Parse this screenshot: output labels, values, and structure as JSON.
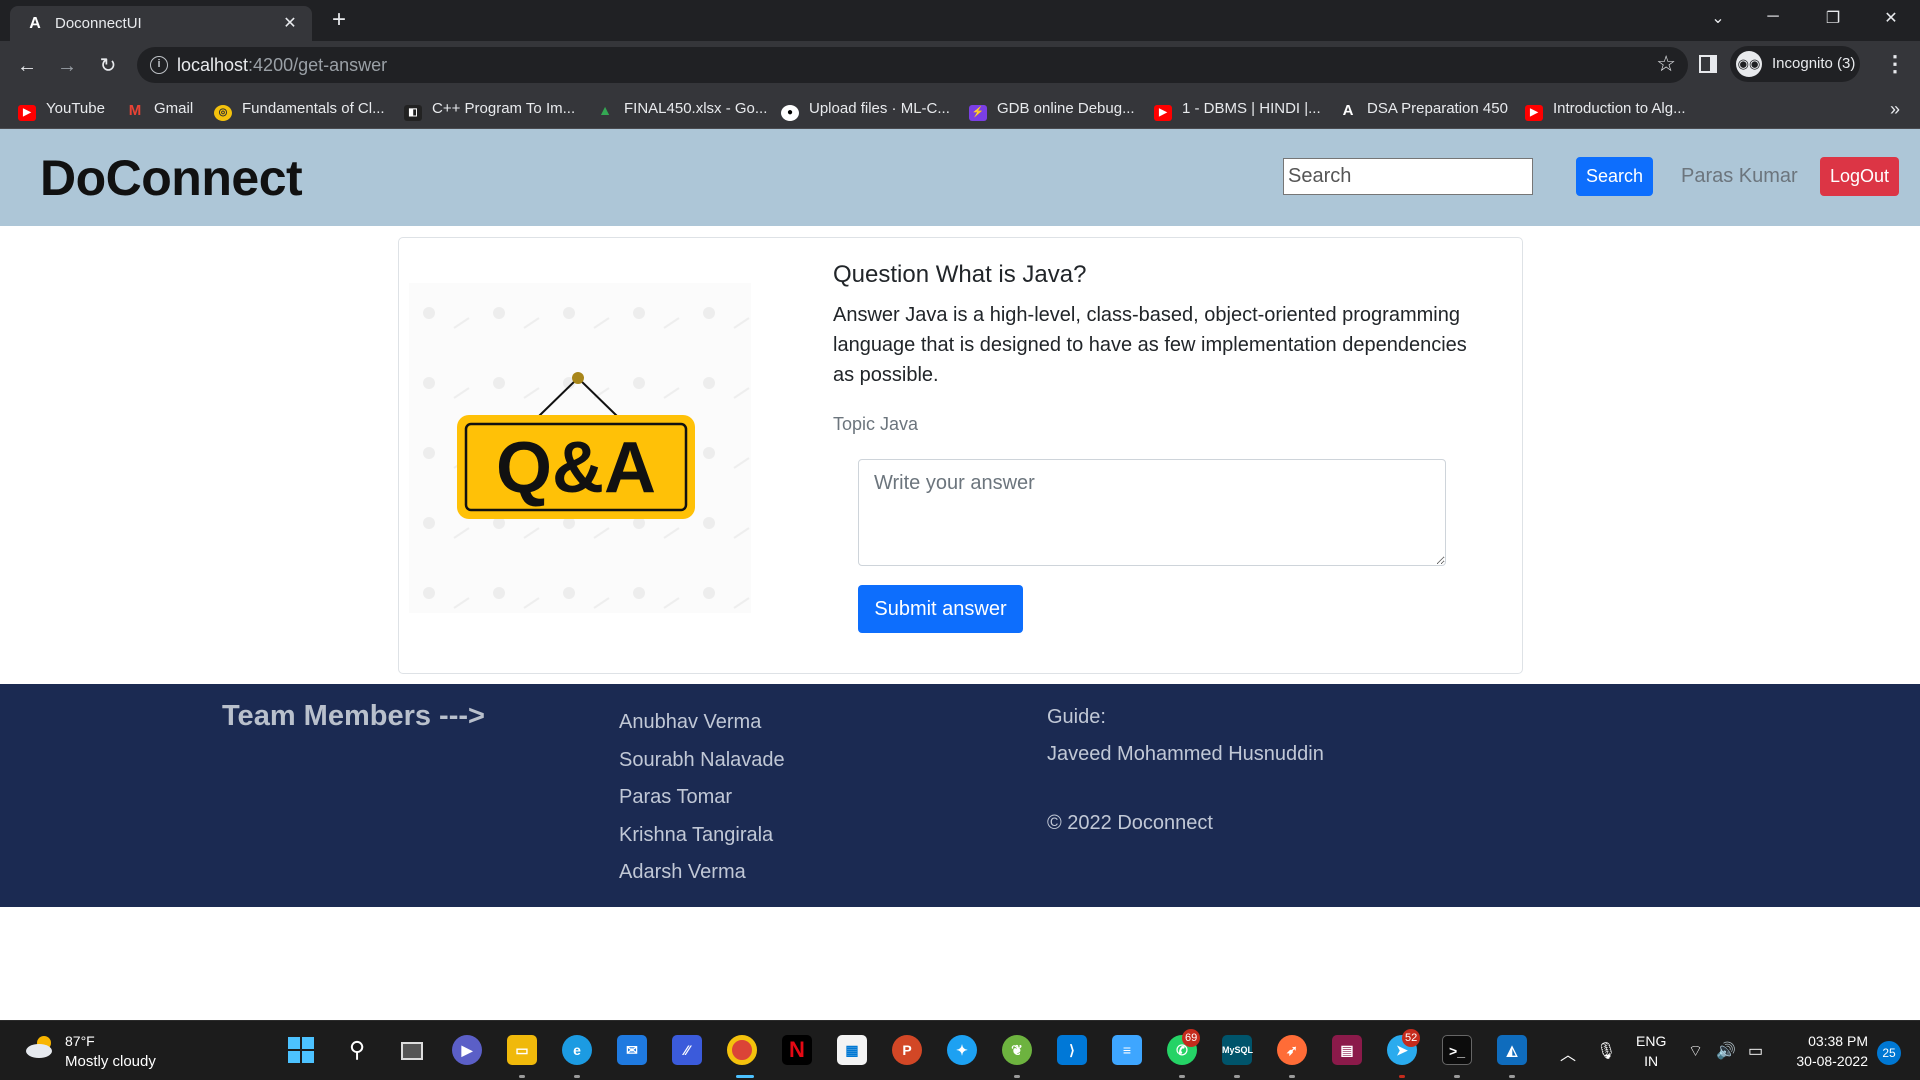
{
  "browser": {
    "tab_title": "DoconnectUI",
    "url_host": "localhost",
    "url_path": ":4200/get-answer",
    "profile_label": "Incognito (3)",
    "bookmarks": [
      {
        "label": "YouTube",
        "icon": "youtube-icon",
        "color": "#ff0000"
      },
      {
        "label": "Gmail",
        "icon": "gmail-icon",
        "color": "#ea4335"
      },
      {
        "label": "Fundamentals of Cl...",
        "icon": "course-icon",
        "color": "#f4c20d"
      },
      {
        "label": "C++ Program To Im...",
        "icon": "gfg-icon",
        "color": "#2f8d46"
      },
      {
        "label": "FINAL450.xlsx - Go...",
        "icon": "drive-icon",
        "color": "#34a853"
      },
      {
        "label": "Upload files · ML-C...",
        "icon": "github-icon",
        "color": "#ffffff"
      },
      {
        "label": "GDB online Debug...",
        "icon": "gdb-icon",
        "color": "#7b3fe4"
      },
      {
        "label": "1 - DBMS | HINDI |...",
        "icon": "youtube-icon",
        "color": "#ff0000"
      },
      {
        "label": "DSA Preparation 450",
        "icon": "angular-icon",
        "color": "#ffffff"
      },
      {
        "label": "Introduction to Alg...",
        "icon": "youtube-icon",
        "color": "#ff0000"
      }
    ]
  },
  "header": {
    "brand": "DoConnect",
    "search_placeholder": "Search",
    "search_button": "Search",
    "user_name": "Paras Kumar",
    "logout_button": "LogOut"
  },
  "card": {
    "image_text": "Q&A",
    "question": "Question What is Java?",
    "answer": "Answer Java is a high-level, class-based, object-oriented programming language that is designed to have as few implementation dependencies as possible.",
    "topic": "Topic Java",
    "answer_placeholder": "Write your answer",
    "submit_button": "Submit answer"
  },
  "footer": {
    "team_heading": "Team Members --->",
    "members": [
      "Anubhav Verma",
      "Sourabh Nalavade",
      "Paras Tomar",
      "Krishna Tangirala",
      "Adarsh Verma"
    ],
    "guide_label": "Guide:",
    "guide_name": "Javeed Mohammed Husnuddin",
    "copyright": "© 2022 Doconnect"
  },
  "taskbar": {
    "weather_temp": "87°F",
    "weather_desc": "Mostly cloudy",
    "lang_line1": "ENG",
    "lang_line2": "IN",
    "time": "03:38 PM",
    "date": "30-08-2022",
    "notification_count": "25",
    "whatsapp_badge": "69",
    "telegram_badge": "52"
  },
  "colors": {
    "header_bg": "#adc6d7",
    "primary": "#0d6efd",
    "danger": "#dc3545",
    "footer_bg": "#1b2a52",
    "qa_sign": "#ffc107"
  }
}
